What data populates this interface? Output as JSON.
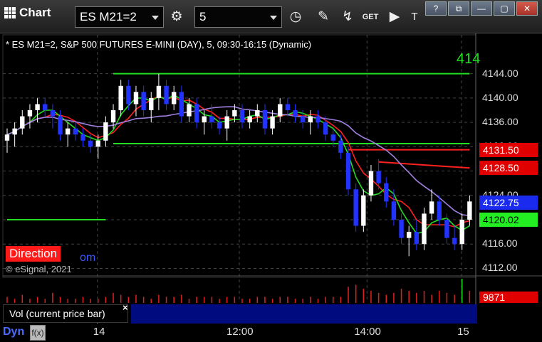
{
  "toolbar": {
    "title": "Chart",
    "symbol": "ES M21=2",
    "interval": "5",
    "window_buttons": [
      "?",
      "⧉",
      "—",
      "▢",
      "✕"
    ]
  },
  "chart_info": "* ES M21=2, S&P 500 FUTURES E-MINI (DAY), 5, 09:30-16:15 (Dynamic)",
  "direction_label": "Direction",
  "direction_suffix": "om",
  "copyright": "© eSignal, 2021",
  "right_clipped_label": "414",
  "vol_label": "Vol (current price bar)",
  "vol_close": "×",
  "dyn_label": "Dyn",
  "dyn_icon": "f(x)",
  "colors": {
    "background": "#000000",
    "up_candle": "#ffffff",
    "down_candle": "#2233ff",
    "green_line": "#22dd22",
    "red_line": "#ff2020",
    "purple_line": "#a080e0",
    "grid": "#444444"
  },
  "chart_data": {
    "type": "candlestick",
    "title": "ES M21=2, S&P 500 FUTURES E-MINI (DAY), 5, 09:30-16:15 (Dynamic)",
    "ylim": [
      4111,
      4147
    ],
    "y_ticks": [
      4112,
      4116,
      4120,
      4124,
      4128,
      4132,
      4136,
      4140,
      4144
    ],
    "y_tick_labels": [
      "4112.00",
      "4116.00",
      "4120.00",
      "4124.00",
      "4128.00",
      "4132.00",
      "4136.00",
      "4140.00",
      "4144.00"
    ],
    "x_ticks": [
      "14",
      "12:00",
      "14:00",
      "15"
    ],
    "x_tick_positions": [
      0.2,
      0.5,
      0.77,
      0.97
    ],
    "candles": [
      {
        "o": 4133,
        "h": 4135,
        "l": 4131,
        "c": 4134
      },
      {
        "o": 4134,
        "h": 4136,
        "l": 4132,
        "c": 4135
      },
      {
        "o": 4135,
        "h": 4138,
        "l": 4134,
        "c": 4137
      },
      {
        "o": 4137,
        "h": 4139,
        "l": 4135,
        "c": 4138
      },
      {
        "o": 4138,
        "h": 4140,
        "l": 4136,
        "c": 4139
      },
      {
        "o": 4139,
        "h": 4140,
        "l": 4137,
        "c": 4138
      },
      {
        "o": 4138,
        "h": 4139,
        "l": 4135,
        "c": 4137
      },
      {
        "o": 4137,
        "h": 4138,
        "l": 4133,
        "c": 4134
      },
      {
        "o": 4134,
        "h": 4136,
        "l": 4132,
        "c": 4135
      },
      {
        "o": 4135,
        "h": 4136,
        "l": 4133,
        "c": 4134
      },
      {
        "o": 4134,
        "h": 4135,
        "l": 4132,
        "c": 4133
      },
      {
        "o": 4133,
        "h": 4134,
        "l": 4131,
        "c": 4132
      },
      {
        "o": 4132,
        "h": 4134,
        "l": 4130,
        "c": 4133
      },
      {
        "o": 4133,
        "h": 4137,
        "l": 4132,
        "c": 4136
      },
      {
        "o": 4136,
        "h": 4139,
        "l": 4135,
        "c": 4138
      },
      {
        "o": 4138,
        "h": 4143,
        "l": 4137,
        "c": 4142
      },
      {
        "o": 4142,
        "h": 4143,
        "l": 4138,
        "c": 4139
      },
      {
        "o": 4139,
        "h": 4142,
        "l": 4137,
        "c": 4141
      },
      {
        "o": 4141,
        "h": 4142,
        "l": 4137,
        "c": 4138
      },
      {
        "o": 4138,
        "h": 4141,
        "l": 4136,
        "c": 4140
      },
      {
        "o": 4140,
        "h": 4144,
        "l": 4138,
        "c": 4142
      },
      {
        "o": 4142,
        "h": 4143,
        "l": 4138,
        "c": 4139
      },
      {
        "o": 4139,
        "h": 4142,
        "l": 4138,
        "c": 4141
      },
      {
        "o": 4141,
        "h": 4142,
        "l": 4136,
        "c": 4137
      },
      {
        "o": 4137,
        "h": 4140,
        "l": 4136,
        "c": 4139
      },
      {
        "o": 4139,
        "h": 4140,
        "l": 4135,
        "c": 4136
      },
      {
        "o": 4136,
        "h": 4138,
        "l": 4134,
        "c": 4137
      },
      {
        "o": 4137,
        "h": 4139,
        "l": 4135,
        "c": 4136
      },
      {
        "o": 4136,
        "h": 4137,
        "l": 4134,
        "c": 4135
      },
      {
        "o": 4135,
        "h": 4138,
        "l": 4133,
        "c": 4137
      },
      {
        "o": 4137,
        "h": 4139,
        "l": 4136,
        "c": 4138
      },
      {
        "o": 4138,
        "h": 4139,
        "l": 4135,
        "c": 4136
      },
      {
        "o": 4136,
        "h": 4138,
        "l": 4135,
        "c": 4137
      },
      {
        "o": 4137,
        "h": 4139,
        "l": 4136,
        "c": 4138
      },
      {
        "o": 4138,
        "h": 4139,
        "l": 4134,
        "c": 4135
      },
      {
        "o": 4135,
        "h": 4138,
        "l": 4134,
        "c": 4137
      },
      {
        "o": 4137,
        "h": 4140,
        "l": 4136,
        "c": 4139
      },
      {
        "o": 4139,
        "h": 4140,
        "l": 4137,
        "c": 4138
      },
      {
        "o": 4138,
        "h": 4139,
        "l": 4136,
        "c": 4137
      },
      {
        "o": 4137,
        "h": 4138,
        "l": 4135,
        "c": 4136
      },
      {
        "o": 4136,
        "h": 4138,
        "l": 4134,
        "c": 4137
      },
      {
        "o": 4137,
        "h": 4138,
        "l": 4135,
        "c": 4136
      },
      {
        "o": 4136,
        "h": 4137,
        "l": 4133,
        "c": 4134
      },
      {
        "o": 4134,
        "h": 4135,
        "l": 4132,
        "c": 4133
      },
      {
        "o": 4133,
        "h": 4134,
        "l": 4130,
        "c": 4131
      },
      {
        "o": 4131,
        "h": 4132,
        "l": 4124,
        "c": 4125
      },
      {
        "o": 4125,
        "h": 4126,
        "l": 4118,
        "c": 4119
      },
      {
        "o": 4119,
        "h": 4125,
        "l": 4118,
        "c": 4124
      },
      {
        "o": 4124,
        "h": 4129,
        "l": 4123,
        "c": 4128
      },
      {
        "o": 4128,
        "h": 4130,
        "l": 4125,
        "c": 4126
      },
      {
        "o": 4126,
        "h": 4127,
        "l": 4122,
        "c": 4123
      },
      {
        "o": 4123,
        "h": 4125,
        "l": 4119,
        "c": 4120
      },
      {
        "o": 4120,
        "h": 4121,
        "l": 4116,
        "c": 4117
      },
      {
        "o": 4117,
        "h": 4119,
        "l": 4114,
        "c": 4118
      },
      {
        "o": 4118,
        "h": 4120,
        "l": 4115,
        "c": 4116
      },
      {
        "o": 4116,
        "h": 4122,
        "l": 4115,
        "c": 4121
      },
      {
        "o": 4121,
        "h": 4125,
        "l": 4120,
        "c": 4123
      },
      {
        "o": 4123,
        "h": 4124,
        "l": 4119,
        "c": 4120
      },
      {
        "o": 4120,
        "h": 4121,
        "l": 4116,
        "c": 4117
      },
      {
        "o": 4117,
        "h": 4119,
        "l": 4115,
        "c": 4116
      },
      {
        "o": 4116,
        "h": 4121,
        "l": 4115,
        "c": 4120
      },
      {
        "o": 4120,
        "h": 4124,
        "l": 4119,
        "c": 4123
      }
    ],
    "lines": [
      {
        "name": "green_vwap_level_high",
        "color": "#22dd22",
        "points": [
          [
            14,
            4144
          ],
          [
            61,
            4144
          ]
        ]
      },
      {
        "name": "green_level_mid",
        "color": "#22dd22",
        "points": [
          [
            14,
            4132.5
          ],
          [
            61,
            4132.5
          ]
        ]
      },
      {
        "name": "green_level_low",
        "color": "#22dd22",
        "points": [
          [
            0,
            4120
          ],
          [
            13,
            4120
          ]
        ]
      },
      {
        "name": "red_level_1",
        "color": "#ff2020",
        "points": [
          [
            45,
            4131.5
          ],
          [
            61,
            4131.5
          ]
        ]
      },
      {
        "name": "red_level_2",
        "color": "#ff2020",
        "points": [
          [
            49,
            4129.5
          ],
          [
            61,
            4128.5
          ]
        ]
      }
    ],
    "price_markers": [
      {
        "value": "4131.50",
        "bg": "#e00000",
        "fg": "#ffffff"
      },
      {
        "value": "4128.50",
        "bg": "#e00000",
        "fg": "#ffffff"
      },
      {
        "value": "4122.75",
        "bg": "#1a2aee",
        "fg": "#ffffff"
      },
      {
        "value": "4120.02",
        "bg": "#22ee22",
        "fg": "#000000"
      }
    ],
    "volume_marker": {
      "value": "9871",
      "bg": "#e00000",
      "fg": "#ffffff"
    },
    "volume": [
      3,
      2,
      4,
      2,
      3,
      2,
      5,
      3,
      2,
      2,
      3,
      2,
      2,
      3,
      5,
      4,
      3,
      4,
      3,
      2,
      4,
      3,
      3,
      4,
      2,
      3,
      3,
      3,
      2,
      3,
      3,
      2,
      2,
      3,
      3,
      2,
      3,
      3,
      2,
      2,
      3,
      2,
      3,
      3,
      3,
      8,
      9,
      7,
      6,
      5,
      4,
      5,
      7,
      6,
      5,
      6,
      4,
      6,
      5,
      4,
      12,
      6
    ]
  }
}
